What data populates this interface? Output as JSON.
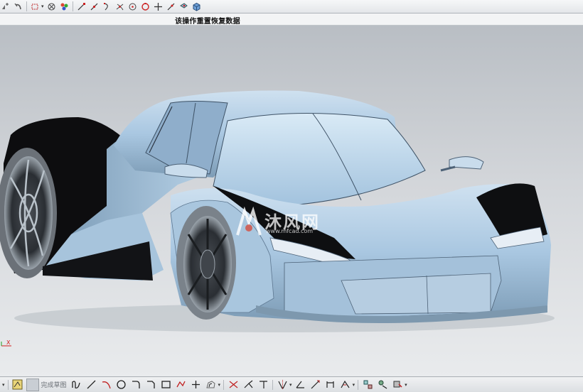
{
  "cue_line": {
    "message": "该操作重置恢复数据"
  },
  "watermark": {
    "main": "沐风网",
    "sub": "www.mfcad.com"
  },
  "triad": {
    "x_label": "X"
  },
  "bottom_toolbar": {
    "finish_sketch_label": "完成草图"
  },
  "colors": {
    "body": "#a8c6e0",
    "shadow": "#6f8ea8",
    "accent": "#d02020"
  }
}
